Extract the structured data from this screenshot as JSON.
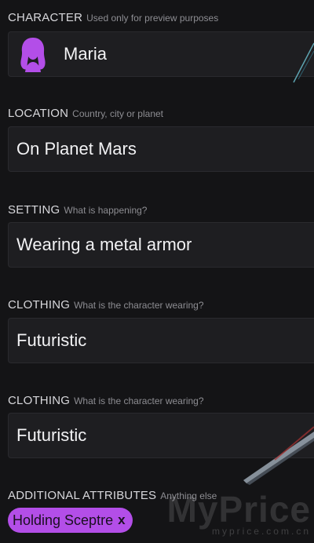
{
  "character": {
    "label": "CHARACTER",
    "hint": "Used only for preview purposes",
    "name": "Maria",
    "avatar_icon": "woman-silhouette-icon",
    "avatar_color": "#b34ee8"
  },
  "location": {
    "label": "LOCATION",
    "hint": "Country, city or planet",
    "value": "On Planet Mars"
  },
  "setting": {
    "label": "SETTING",
    "hint": "What is happening?",
    "value": "Wearing a metal armor"
  },
  "clothing": [
    {
      "label": "CLOTHING",
      "hint": "What is the character wearing?",
      "value": "Futuristic"
    },
    {
      "label": "CLOTHING",
      "hint": "What is the character wearing?",
      "value": "Futuristic"
    }
  ],
  "additional": {
    "label": "ADDITIONAL ATTRIBUTES",
    "hint": "Anything else",
    "tags": [
      {
        "text": "Holding Sceptre",
        "remove": "x"
      }
    ],
    "tag_color": "#b34ee8"
  },
  "watermark": {
    "main": "MyPrice",
    "sub": "myprice.com.cn"
  }
}
